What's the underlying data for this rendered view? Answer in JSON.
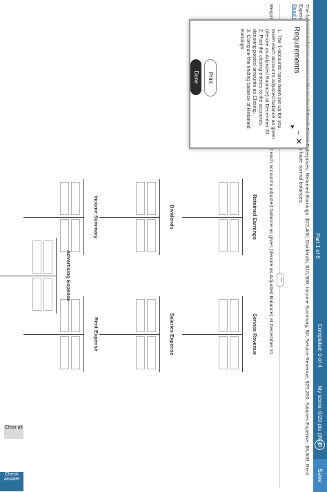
{
  "header": {
    "part": "Part 1 of 6",
    "completed": "Completed: 0 of 4",
    "score": "My score: 0/20 pts (0%)",
    "save_label": "Save"
  },
  "question": {
    "text": "The following balances appear on the books of Sarah Simon Enterprises: Retained Earnings, $22,400; Dividends, $10,600; Income Summary, $0; Service Revenue, $25,200; Salaries Expense, $6,600; Rent Expense $3,800; and Advertising Expense, $2,000. All accounts have normal balances.",
    "read_link": "Read the requirements.",
    "requirement_line": "Requirement 1. The T-accounts have been set up for you. Insert each account's adjusted balance as given (denote as Adjusted Balance) at December 31."
  },
  "taccounts": [
    {
      "title": "Retained Earnings"
    },
    {
      "title": "Service Revenue"
    },
    {
      "title": "Dividends"
    },
    {
      "title": "Salaries Expense"
    },
    {
      "title": "Income Summary"
    },
    {
      "title": "Rent Expense"
    },
    {
      "title": "Advertising Expense"
    }
  ],
  "footer": {
    "clear_all": "Clear all",
    "check_answer": "Check answer"
  },
  "modal": {
    "title": "Requirements",
    "items": [
      "1. The T-accounts have been set up for you. Insert each account's adjusted balance as given (denote as Adjusted Balance) at December 31.",
      "2. Post the closing entries to the accounts, denoting posted amounts as Closing.",
      "3. Compute the ending balance of Retained Earnings."
    ],
    "print_label": "Print",
    "done_label": "Done"
  }
}
